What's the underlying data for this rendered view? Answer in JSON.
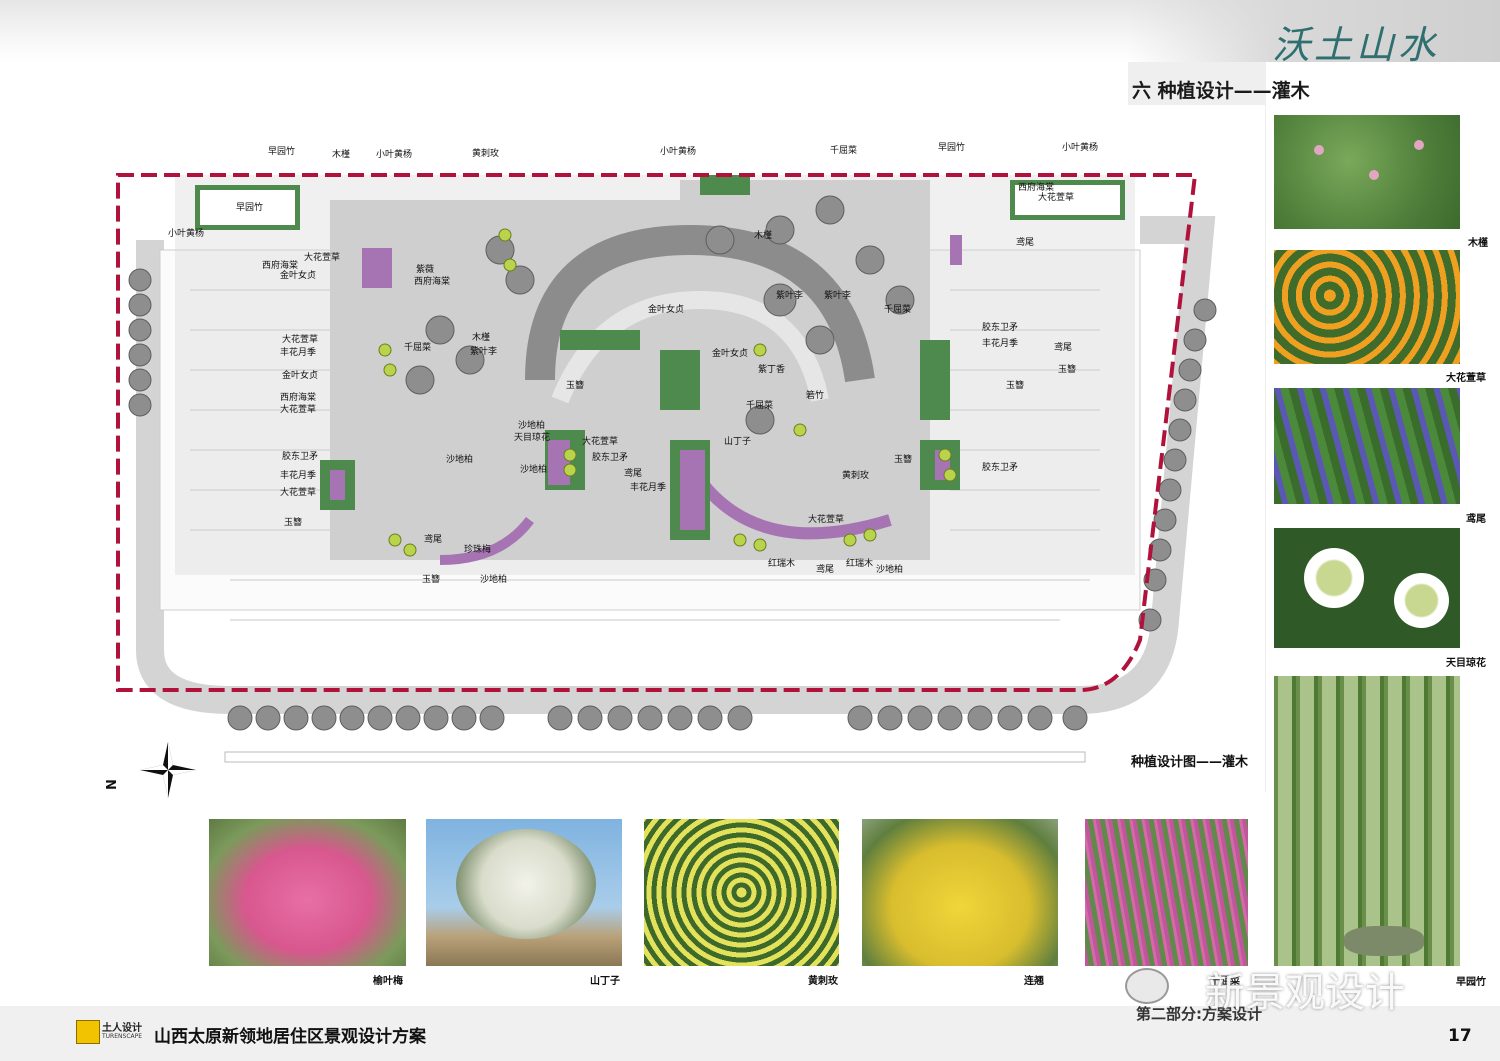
{
  "header": {
    "calligraphy": "沃土山水",
    "section_title": "六  种植设计——灌木"
  },
  "plan": {
    "caption": "种植设计图——灌木",
    "north": "N",
    "labels": {
      "l1": "早园竹",
      "l2": "木槿",
      "l3": "小叶黄杨",
      "l4": "黄刺玫",
      "l5": "小叶黄杨",
      "l6": "千屈菜",
      "l7": "早园竹",
      "l8": "小叶黄杨",
      "l9": "早园竹",
      "l10": "小叶黄杨",
      "l11": "大花萱草",
      "l12": "西府海棠",
      "l13": "金叶女贞",
      "l14": "大花萱草",
      "l15": "丰花月季",
      "l16": "金叶女贞",
      "l17": "西府海棠",
      "l18": "大花萱草",
      "l19": "胶东卫矛",
      "l20": "丰花月季",
      "l21": "大花萱草",
      "l22": "玉簪",
      "l23": "紫薇",
      "l24": "西府海棠",
      "l25": "千屈菜",
      "l26": "木槿",
      "l27": "紫叶李",
      "l28": "沙地柏",
      "l29": "天目琼花",
      "l30": "沙地柏",
      "l31": "珍珠梅",
      "l32": "玉簪",
      "l33": "沙地柏",
      "l34": "鸢尾",
      "l35": "大花萱草",
      "l36": "胶东卫矛",
      "l37": "鸢尾",
      "l38": "丰花月季",
      "l39": "山丁子",
      "l40": "金叶女贞",
      "l41": "紫丁香",
      "l42": "千屈菜",
      "l43": "紫叶李",
      "l44": "红瑞木",
      "l45": "鸢尾",
      "l46": "红瑞木",
      "l47": "沙地柏",
      "l48": "大花萱草",
      "l49": "黄刺玫",
      "l50": "箬竹",
      "l51": "鸢尾",
      "l52": "胶东卫矛",
      "l53": "丰花月季",
      "l54": "玉簪",
      "l55": "鸢尾",
      "l56": "玉簪",
      "l57": "胶东卫矛",
      "l58": "玉簪",
      "l59": "西府海棠",
      "l60": "大花萱草",
      "l61": "紫叶李",
      "l62": "千屈菜",
      "l63": "玉簪",
      "l64": "沙地柏",
      "l65": "木槿",
      "l66": "金叶女贞"
    }
  },
  "right_photos": [
    {
      "caption": "木槿"
    },
    {
      "caption": "大花萱草"
    },
    {
      "caption": "鸢尾"
    },
    {
      "caption": "天目琼花"
    },
    {
      "caption": "早园竹"
    }
  ],
  "bottom_photos": [
    {
      "caption": "榆叶梅"
    },
    {
      "caption": "山丁子"
    },
    {
      "caption": "黄刺玫"
    },
    {
      "caption": "连翘"
    },
    {
      "caption": "千屈菜"
    }
  ],
  "footer": {
    "logo_name": "土人设计",
    "logo_en": "TURENSCAPE",
    "project": "山西太原新领地居住区景观设计方案",
    "part": "第二部分:方案设计",
    "page": "17",
    "watermark": "新景观设计"
  }
}
